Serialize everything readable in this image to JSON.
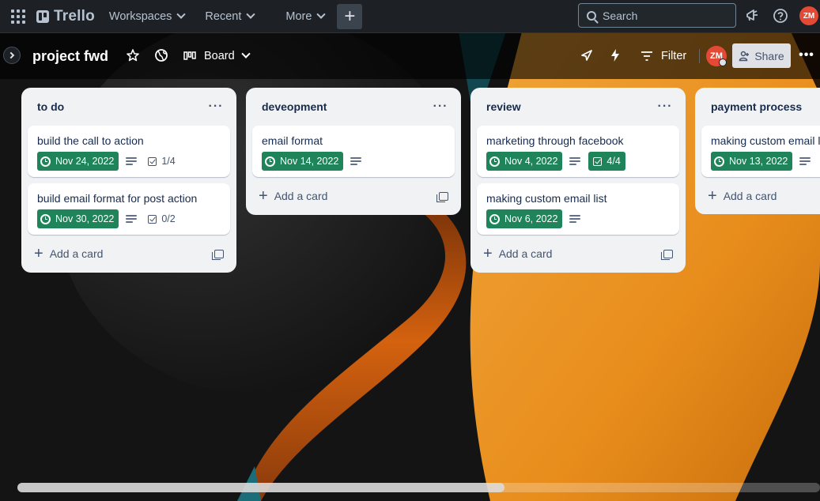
{
  "app": {
    "name": "Trello"
  },
  "topnav": {
    "workspaces": "Workspaces",
    "recent": "Recent",
    "more": "More",
    "create": "+",
    "search_label": "Search",
    "user_initials": "ZM"
  },
  "board": {
    "title": "project fwd",
    "view": "Board",
    "filter": "Filter",
    "share": "Share",
    "member_initials": "ZM"
  },
  "add_card_label": "Add a card",
  "lists": [
    {
      "title": "to do",
      "cards": [
        {
          "title": "build the call to action",
          "due": "Nov 24, 2022",
          "checklist": "1/4"
        },
        {
          "title": "build email format for post action",
          "due": "Nov 30, 2022",
          "checklist": "0/2"
        }
      ]
    },
    {
      "title": "deveopment",
      "cards": [
        {
          "title": "email format",
          "due": "Nov 14, 2022"
        }
      ]
    },
    {
      "title": "review",
      "cards": [
        {
          "title": "marketing through facebook",
          "due": "Nov 4, 2022",
          "checklist": "4/4"
        },
        {
          "title": "making custom email list",
          "due": "Nov 6, 2022"
        }
      ]
    },
    {
      "title": "payment process",
      "cards": [
        {
          "title": "making custom email list",
          "due": "Nov 13, 2022"
        }
      ]
    }
  ],
  "colors": {
    "topnav_bg": "#1d2125",
    "due_badge": "#1f845a",
    "list_bg": "#f1f2f4",
    "avatar": "#e34935",
    "accent_orange": "#e8951f"
  },
  "scroll": {
    "position_fraction": 0.6
  }
}
